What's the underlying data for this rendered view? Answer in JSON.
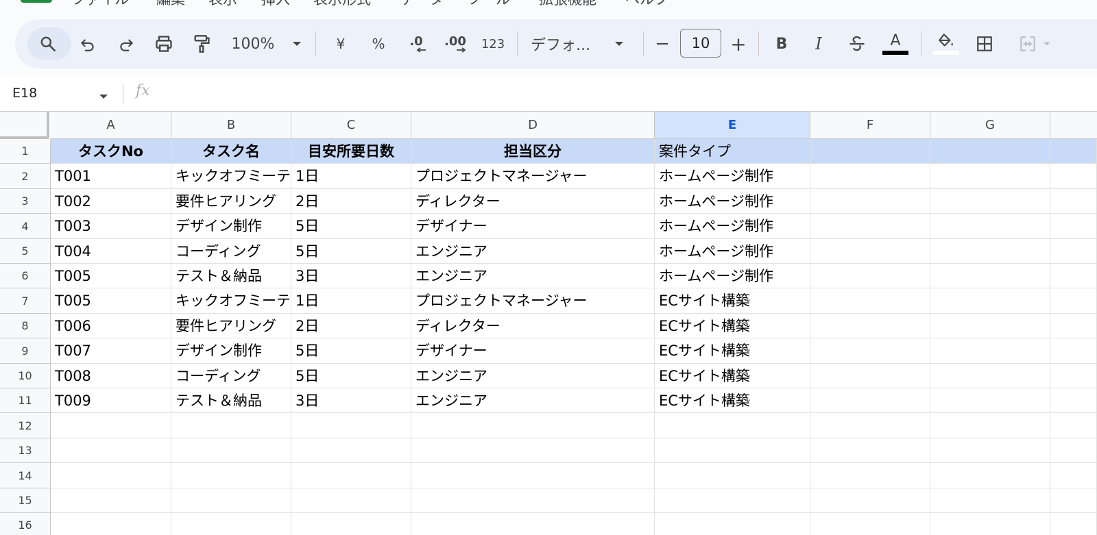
{
  "menu": [
    "ファイル",
    "編集",
    "表示",
    "挿入",
    "表示形式",
    "データ",
    "ツール",
    "拡張機能",
    "ヘルプ"
  ],
  "toolbar": {
    "zoom": "100%",
    "currency": "¥",
    "percent": "%",
    "decrease_decimal": ".0",
    "increase_decimal": ".00",
    "number_format": "123",
    "font": "デフォ...",
    "font_size": "10",
    "minus": "−",
    "plus": "+",
    "bold": "B",
    "italic": "I",
    "text_color_letter": "A",
    "text_color": "#000000",
    "fill_color": "#ffffff"
  },
  "formula_bar": {
    "cell_ref": "E18",
    "fx": "fx",
    "value": ""
  },
  "columns": [
    "A",
    "B",
    "C",
    "D",
    "E",
    "F",
    "G"
  ],
  "selected_column": "E",
  "rows": [
    "1",
    "2",
    "3",
    "4",
    "5",
    "6",
    "7",
    "8",
    "9",
    "10",
    "11",
    "12",
    "13",
    "14",
    "15",
    "16"
  ],
  "headers": [
    "タスクNo",
    "タスク名",
    "目安所要日数",
    "担当区分",
    "案件タイプ"
  ],
  "data": [
    [
      "T001",
      "キックオフミーティング",
      "1日",
      "プロジェクトマネージャー",
      "ホームページ制作"
    ],
    [
      "T002",
      "要件ヒアリング",
      "2日",
      "ディレクター",
      "ホームページ制作"
    ],
    [
      "T003",
      "デザイン制作",
      "5日",
      "デザイナー",
      "ホームページ制作"
    ],
    [
      "T004",
      "コーディング",
      "5日",
      "エンジニア",
      "ホームページ制作"
    ],
    [
      "T005",
      "テスト＆納品",
      "3日",
      "エンジニア",
      "ホームページ制作"
    ],
    [
      "T005",
      "キックオフミーティング",
      "1日",
      "プロジェクトマネージャー",
      "ECサイト構築"
    ],
    [
      "T006",
      "要件ヒアリング",
      "2日",
      "ディレクター",
      "ECサイト構築"
    ],
    [
      "T007",
      "デザイン制作",
      "5日",
      "デザイナー",
      "ECサイト構築"
    ],
    [
      "T008",
      "コーディング",
      "5日",
      "エンジニア",
      "ECサイト構築"
    ],
    [
      "T009",
      "テスト＆納品",
      "3日",
      "エンジニア",
      "ECサイト構築"
    ]
  ],
  "colors": {
    "header_fill": "#c9daf8",
    "selected_col": "#d3e3fd",
    "toolbar_bg": "#edf2fa",
    "brand_green": "#1e8e3e"
  }
}
